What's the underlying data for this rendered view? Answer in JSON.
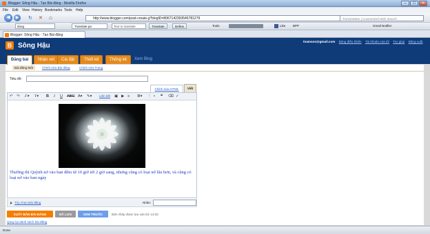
{
  "window": {
    "title": "Blogger: Sông Hậu - Tạo Bài đăng - Mozilla Firefox"
  },
  "menu": [
    "File",
    "Edit",
    "View",
    "History",
    "Bookmarks",
    "Tools",
    "Help"
  ],
  "nav": {
    "url": "http://www.blogger.com/post-create.g?blogID=8067142393545781279",
    "search_placeholder": "TranslateBar | Customized Web Search"
  },
  "toolbar": {
    "field1": "dong",
    "translate_label": "Translate pa",
    "text_to_translate": "Text to translate",
    "translate_btn": "Translate",
    "define_btn": "Define",
    "tools": "Tools",
    "like": "Like",
    "bpp": "BPP",
    "gmail": "Gmail Notifier"
  },
  "browser_tab": {
    "label": "Blogger: Sông Hậu - Tạo Bài đăng"
  },
  "blog": {
    "name": "Sông Hậu",
    "user": "tnamson@gmail.com",
    "links": [
      "Bảng điều khiển",
      "Tài khoản của tôi",
      "Trợ giúp",
      "Đăng xuất"
    ]
  },
  "main_tabs": [
    "Đăng bài",
    "Nhận xét",
    "Cài đặt",
    "Thiết kế",
    "Thống kê",
    "Xem Blog"
  ],
  "sub_tabs": [
    "Bài đăng Mới",
    "Chỉnh sửa Bài đăng",
    "Chỉnh sửa Trang"
  ],
  "editor": {
    "title_label": "Tiêu đề:",
    "mode_html": "Chỉnh sửa HTML",
    "mode_compose": "Viết",
    "link_label": "Liên kết",
    "body": "Thường thì Quỳnh nở vào ban đêm từ 10 giờ tới 2 giờ sang, nhưng cũng có loại nở lâu hơn, và cũng có loại nở vào ban ngày",
    "post_options": "Tùy chọn Bài đăng",
    "labels_label": "Nhãn:"
  },
  "actions": {
    "publish": "XUẤT BẢN BÀI ĐĂNG",
    "saved": "ĐÃ LƯU",
    "preview": "XEM TRƯỚC",
    "saved_msg": "Bản nháp được lưu vào lúc 14:02",
    "back": "Quay lại danh sách bài đăng"
  },
  "status": {
    "text": "Done"
  },
  "colors": {
    "blogger_header": "#0f3b79",
    "tab_orange": "#e48b1e",
    "link_blue": "#2a63c7",
    "body_text": "#1c38b8",
    "publish": "#f57d00",
    "preview": "#6d9eeb"
  },
  "icons": [
    "firefox-icon",
    "back-icon",
    "forward-icon",
    "reload-icon",
    "stop-icon",
    "home-icon",
    "blogger-icon",
    "bold-icon",
    "italic-icon",
    "underline-icon",
    "strike-icon",
    "image-icon",
    "video-icon",
    "list-icon",
    "quote-icon",
    "spellcheck-icon"
  ]
}
